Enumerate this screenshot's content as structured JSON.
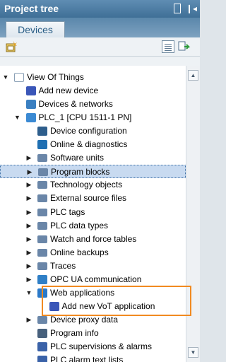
{
  "panel": {
    "title": "Project tree",
    "pin_icon": "pin-icon",
    "collapse_icon": "collapse-icon"
  },
  "tabs": [
    {
      "label": "Devices"
    }
  ],
  "toolbar": {
    "add_icon": "add-device-icon",
    "view_icon": "view-overview-icon",
    "sync_icon": "sync-icon"
  },
  "tree": [
    {
      "label": "View Of Things",
      "expander": "open",
      "icon": "project-icon",
      "color": "#ffffff"
    },
    {
      "label": "Add new device",
      "expander": "none",
      "icon": "add-device-icon",
      "color": "#3a56b8"
    },
    {
      "label": "Devices & networks",
      "expander": "none",
      "icon": "network-icon",
      "color": "#3a7fc1"
    },
    {
      "label": "PLC_1 [CPU 1511-1 PN]",
      "expander": "open",
      "icon": "plc-icon",
      "color": "#3b8ad3"
    },
    {
      "label": "Device configuration",
      "expander": "none",
      "icon": "device-config-icon",
      "color": "#2e5e8c"
    },
    {
      "label": "Online & diagnostics",
      "expander": "none",
      "icon": "diagnostics-icon",
      "color": "#1f6fb2"
    },
    {
      "label": "Software units",
      "expander": "closed",
      "icon": "folder-icon",
      "color": "#6a86a8"
    },
    {
      "label": "Program blocks",
      "expander": "closed",
      "icon": "folder-icon",
      "color": "#6a86a8",
      "selected": true
    },
    {
      "label": "Technology objects",
      "expander": "closed",
      "icon": "folder-icon",
      "color": "#6a86a8"
    },
    {
      "label": "External source files",
      "expander": "closed",
      "icon": "folder-icon",
      "color": "#6a86a8"
    },
    {
      "label": "PLC tags",
      "expander": "closed",
      "icon": "folder-icon",
      "color": "#6a86a8"
    },
    {
      "label": "PLC data types",
      "expander": "closed",
      "icon": "folder-icon",
      "color": "#6a86a8"
    },
    {
      "label": "Watch and force tables",
      "expander": "closed",
      "icon": "folder-icon",
      "color": "#6a86a8"
    },
    {
      "label": "Online backups",
      "expander": "closed",
      "icon": "folder-icon",
      "color": "#6a86a8"
    },
    {
      "label": "Traces",
      "expander": "closed",
      "icon": "folder-icon",
      "color": "#6a86a8"
    },
    {
      "label": "OPC UA communication",
      "expander": "closed",
      "icon": "opc-ua-icon",
      "color": "#2f7fc6"
    },
    {
      "label": "Web applications",
      "expander": "open",
      "icon": "web-icon",
      "color": "#2a79c9"
    },
    {
      "label": "Add new VoT application",
      "expander": "none",
      "icon": "add-app-icon",
      "color": "#3a56b8"
    },
    {
      "label": "Device proxy data",
      "expander": "closed",
      "icon": "folder-icon",
      "color": "#6a86a8"
    },
    {
      "label": "Program info",
      "expander": "none",
      "icon": "program-info-icon",
      "color": "#47607c"
    },
    {
      "label": "PLC supervisions & alarms",
      "expander": "none",
      "icon": "alarms-icon",
      "color": "#3a62a8"
    },
    {
      "label": "PLC alarm text lists",
      "expander": "none",
      "icon": "alarm-text-icon",
      "color": "#3a62a8"
    }
  ],
  "highlight_color": "#f18a21"
}
